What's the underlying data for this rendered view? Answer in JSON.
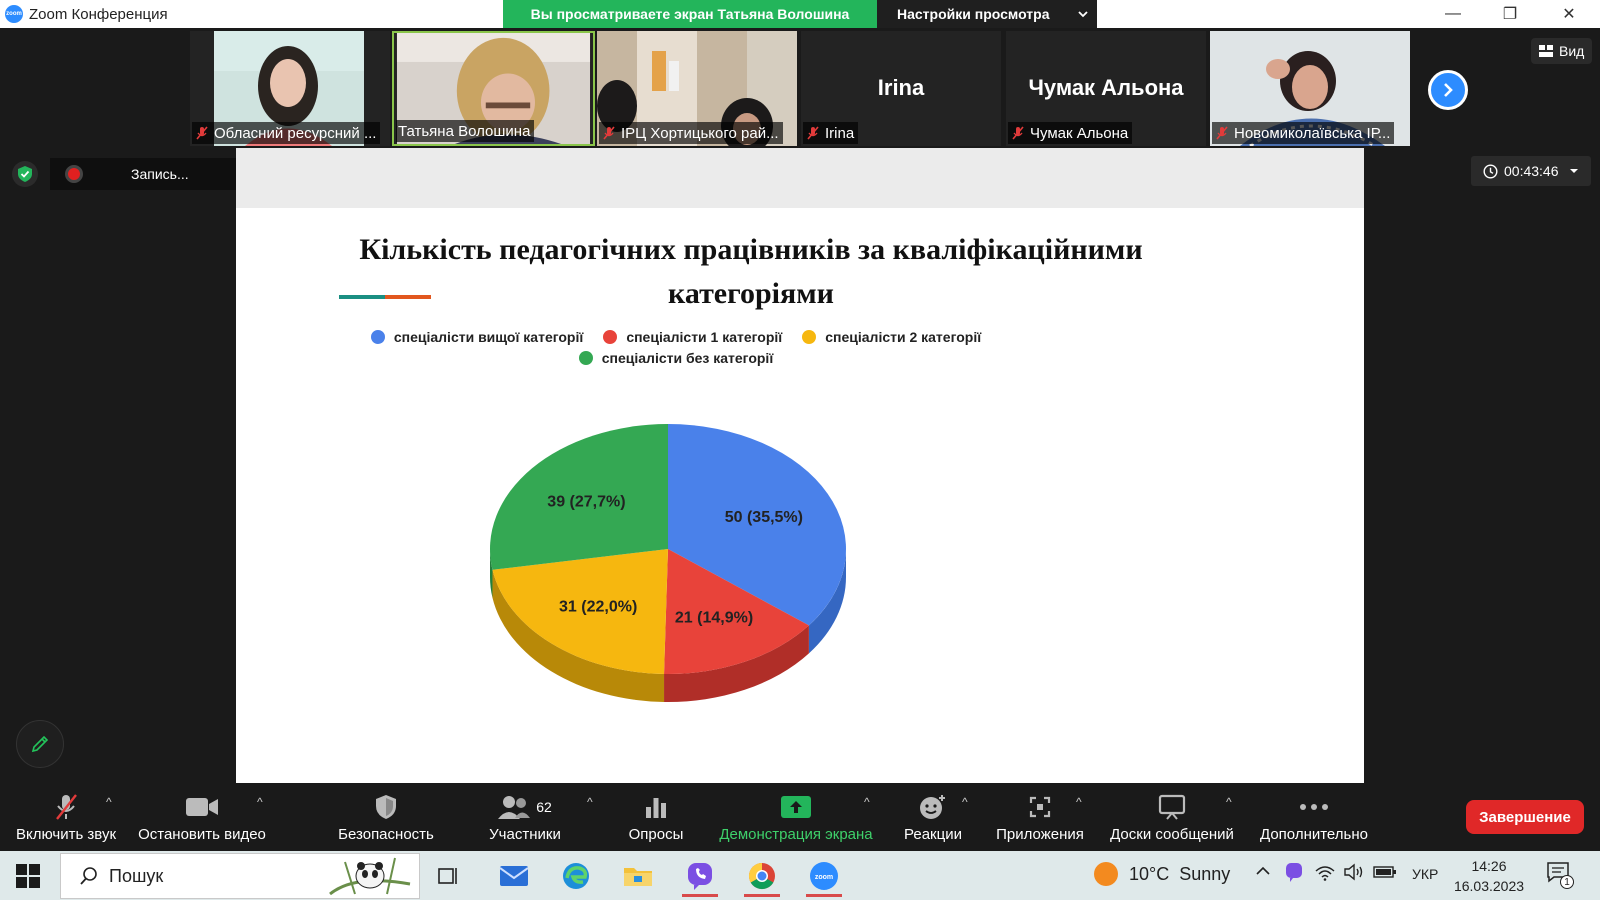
{
  "titlebar": {
    "app_title": "Zoom Конференция",
    "zoom_badge": "zoom",
    "share_banner": "Вы просматриваете экран Татьяна Волошина",
    "view_settings": "Настройки просмотра",
    "minimize": "—",
    "restore": "❐",
    "close": "✕"
  },
  "participants": [
    {
      "name": "Обласний ресурсний ...",
      "muted": true,
      "video": "woman-pink"
    },
    {
      "name": "Татьяна Волошина",
      "muted": false,
      "video": "woman-blonde",
      "active": true
    },
    {
      "name": "ІРЦ Хортицького рай...",
      "muted": true,
      "video": "office"
    },
    {
      "name": "Irina",
      "muted": true,
      "big_name": "Irina"
    },
    {
      "name": "Чумак Альона",
      "muted": true,
      "big_name": "Чумак Альона"
    },
    {
      "name": "Новомиколаївська ІР...",
      "muted": true,
      "video": "woman-dark"
    }
  ],
  "view_button": "Вид",
  "recording": {
    "label": "Запись..."
  },
  "timer": "00:43:46",
  "slide": {
    "title_line1": "Кількість педагогічних працівників за кваліфікаційними",
    "title_line2": "категоріями"
  },
  "chart_data": {
    "type": "pie",
    "title": "Кількість педагогічних працівників за кваліфікаційними категоріями",
    "legend_placement": "top",
    "series": [
      {
        "name": "спеціалісти вищої категорії",
        "value": 50,
        "percent": "35,5%",
        "label": "50 (35,5%)",
        "color": "#4a81ea",
        "side": "#3567c2"
      },
      {
        "name": "спеціалісти 1 категорії",
        "value": 21,
        "percent": "14,9%",
        "label": "21 (14,9%)",
        "color": "#e8433a",
        "side": "#b02e28"
      },
      {
        "name": "спеціалісти 2 категорії",
        "value": 31,
        "percent": "22,0%",
        "label": "31 (22,0%)",
        "color": "#f6b70f",
        "side": "#b88908"
      },
      {
        "name": "спеціалісти без категорії",
        "value": 39,
        "percent": "27,7%",
        "label": "39 (27,7%)",
        "color": "#34a853",
        "side": "#23803c"
      }
    ]
  },
  "toolbar": {
    "unmute": "Включить звук",
    "stop_video": "Остановить видео",
    "security": "Безопасность",
    "participants": "Участники",
    "participants_count": "62",
    "polls": "Опросы",
    "share_screen": "Демонстрация экрана",
    "reactions": "Реакции",
    "apps": "Приложения",
    "whiteboards": "Доски сообщений",
    "more": "Дополнительно",
    "end": "Завершение",
    "caret": "^"
  },
  "taskbar": {
    "search_placeholder": "Пошук",
    "weather_temp": "10°C",
    "weather_cond": "Sunny",
    "lang": "УКР",
    "time": "14:26",
    "date": "16.03.2023",
    "notifications": "1"
  },
  "colors": {
    "share_green": "#23b55b",
    "accent_blue": "#2d8cff",
    "end_red": "#e02828",
    "share_label_green": "#3ed06a"
  }
}
